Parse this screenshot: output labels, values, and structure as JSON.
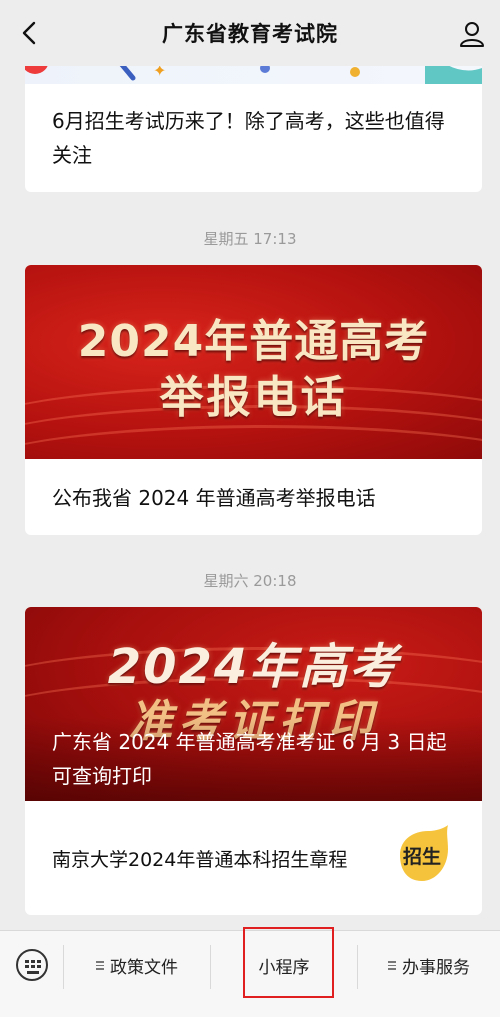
{
  "header": {
    "title": "广东省教育考试院"
  },
  "feed": {
    "card1": {
      "text": "6月招生考试历来了！除了高考，这些也值得关注"
    },
    "time1": "星期五 17:13",
    "card2": {
      "banner_line1": "2024年普通高考",
      "banner_line2": "举报电话",
      "caption": "公布我省 2024 年普通高考举报电话"
    },
    "time2": "星期六 20:18",
    "card3": {
      "banner_line1": "2024年高考",
      "banner_line2": "准考证打印",
      "overlay_text": "广东省 2024 年普通高考准考证 6 月 3 日起可查询打印",
      "caption": "南京大学2024年普通本科招生章程",
      "badge": "招生"
    }
  },
  "bottombar": {
    "item1": "政策文件",
    "item2": "小程序",
    "item3": "办事服务"
  },
  "colors": {
    "banner_red": "#c0150f",
    "highlight": "#e02020",
    "background": "#ededed"
  }
}
